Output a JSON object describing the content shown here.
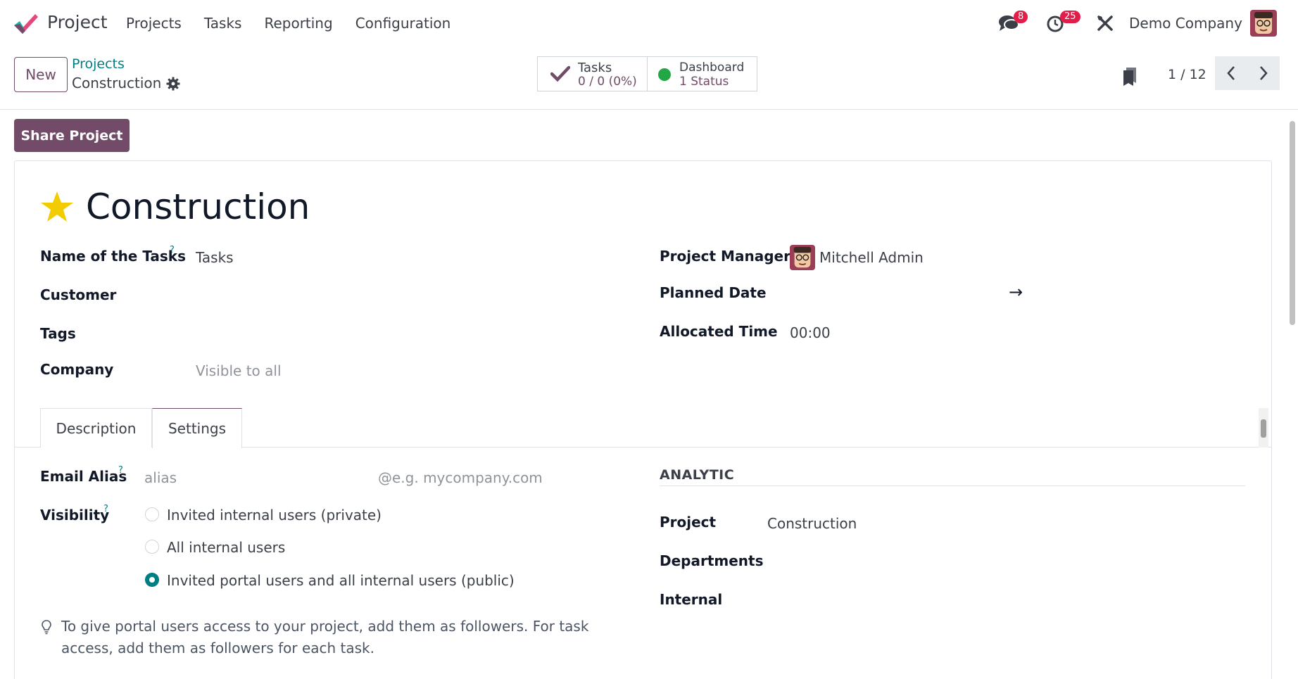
{
  "navbar": {
    "app_name": "Project",
    "menu": [
      "Projects",
      "Tasks",
      "Reporting",
      "Configuration"
    ],
    "messages_badge": "8",
    "activities_badge": "25",
    "company": "Demo Company"
  },
  "control_panel": {
    "new_label": "New",
    "breadcrumb_parent": "Projects",
    "breadcrumb_current": "Construction",
    "tasks_stat": {
      "label": "Tasks",
      "value": "0 / 0 (0%)"
    },
    "dashboard_stat": {
      "label": "Dashboard",
      "value": "1 Status"
    },
    "pager": "1 / 12"
  },
  "share_label": "Share Project",
  "form": {
    "title": "Construction",
    "fields_left": [
      {
        "label": "Name of the Tasks",
        "help": "?",
        "value": "Tasks"
      },
      {
        "label": "Customer",
        "value": ""
      },
      {
        "label": "Tags",
        "value": ""
      },
      {
        "label": "Company",
        "placeholder": "Visible to all"
      }
    ],
    "fields_right": [
      {
        "label": "Project Manager",
        "value": "Mitchell Admin"
      },
      {
        "label": "Planned Date",
        "value": "→"
      },
      {
        "label": "Allocated Time",
        "value": "00:00"
      }
    ],
    "tabs": [
      "Description",
      "Settings"
    ],
    "active_tab": "Settings"
  },
  "settings": {
    "email_alias_label": "Email Alias",
    "email_alias_help": "?",
    "alias_placeholder": "alias",
    "domain_placeholder": "@e.g. mycompany.com",
    "visibility_label": "Visibility",
    "visibility_help": "?",
    "visibility_options": [
      {
        "label": "Invited internal users (private)",
        "checked": false
      },
      {
        "label": "All internal users",
        "checked": false
      },
      {
        "label": "Invited portal users and all internal users (public)",
        "checked": true
      }
    ],
    "hint": "To give portal users access to your project, add them as followers. For task access, add them as followers for each task.",
    "analytic_heading": "ANALYTIC",
    "analytic_fields": [
      {
        "label": "Project",
        "value": "Construction"
      },
      {
        "label": "Departments",
        "value": ""
      },
      {
        "label": "Internal",
        "value": ""
      }
    ]
  },
  "colors": {
    "brand": "#714b67",
    "link": "#017e84",
    "badge": "#e11d48",
    "star": "#f3cc00",
    "status_green": "#22a745"
  }
}
